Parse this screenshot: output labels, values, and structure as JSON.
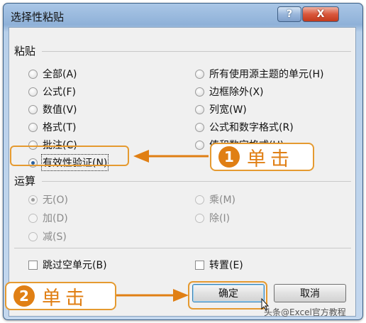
{
  "dialog": {
    "title": "选择性粘贴",
    "help_label": "?",
    "close_label": "X"
  },
  "paste": {
    "label": "粘贴",
    "left_options": [
      {
        "label": "全部(A)",
        "checked": false
      },
      {
        "label": "公式(F)",
        "checked": false
      },
      {
        "label": "数值(V)",
        "checked": false
      },
      {
        "label": "格式(T)",
        "checked": false
      },
      {
        "label": "批注(C)",
        "checked": false
      },
      {
        "label": "有效性验证(N)",
        "checked": true
      }
    ],
    "right_options": [
      {
        "label": "所有使用源主题的单元(H)"
      },
      {
        "label": "边框除外(X)"
      },
      {
        "label": "列宽(W)"
      },
      {
        "label": "公式和数字格式(R)"
      },
      {
        "label": "值和数字格式(U)"
      }
    ]
  },
  "operation": {
    "label": "运算",
    "left_options": [
      {
        "label": "无(O)",
        "checked": true
      },
      {
        "label": "加(D)",
        "checked": false
      },
      {
        "label": "减(S)",
        "checked": false
      }
    ],
    "right_options": [
      {
        "label": "乘(M)"
      },
      {
        "label": "除(I)"
      }
    ]
  },
  "checks": {
    "skip_blanks": "跳过空单元(B)",
    "transpose": "转置(E)"
  },
  "buttons": {
    "ok": "确定",
    "cancel": "取消"
  },
  "callouts": {
    "step1_number": "1",
    "step1_text": "单击",
    "step2_number": "2",
    "step2_text": "单击"
  },
  "watermark": "头条@Excel官方教程",
  "colors": {
    "accent": "#e07f14",
    "title_bar": "#8fb1d8",
    "close_button": "#d9573c"
  }
}
